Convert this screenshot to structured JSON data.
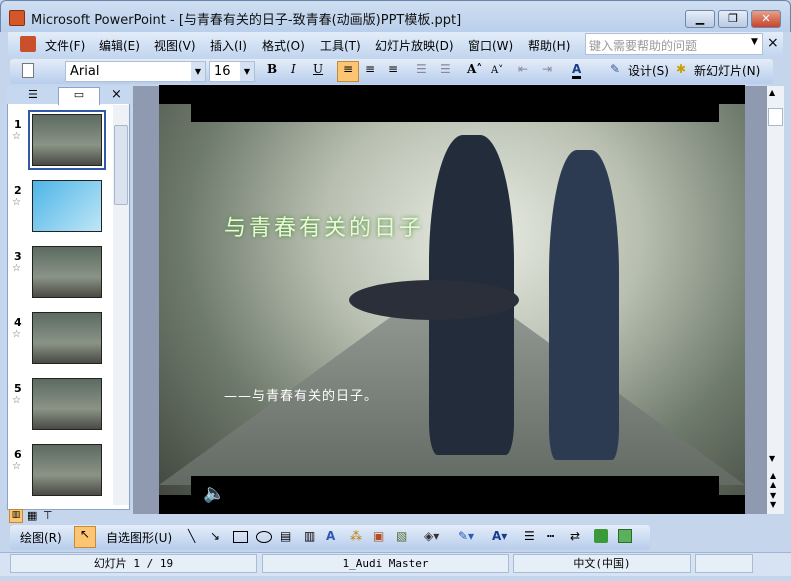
{
  "window": {
    "title": "Microsoft PowerPoint - [与青春有关的日子-致青春(动画版)PPT模板.ppt]",
    "minimize": "▁",
    "restore": "❐",
    "close": "✕"
  },
  "menu": [
    "文件(F)",
    "编辑(E)",
    "视图(V)",
    "插入(I)",
    "格式(O)",
    "工具(T)",
    "幻灯片放映(D)",
    "窗口(W)",
    "帮助(H)"
  ],
  "help": {
    "placeholder": "键入需要帮助的问题",
    "close": "×"
  },
  "toolbar": {
    "font": "Arial",
    "size": "16",
    "bold": "B",
    "italic": "I",
    "underline": "U",
    "grow": "A˄",
    "shrink": "A˅",
    "font_color": "A",
    "design": "设计(S)",
    "new_slide": "新幻灯片(N)"
  },
  "pane": {
    "close": "×",
    "slides": [
      {
        "n": "1",
        "star": "☆"
      },
      {
        "n": "2",
        "star": "☆"
      },
      {
        "n": "3",
        "star": "☆"
      },
      {
        "n": "4",
        "star": "☆"
      },
      {
        "n": "5",
        "star": "☆"
      },
      {
        "n": "6",
        "star": "☆"
      }
    ]
  },
  "slide": {
    "title": "与青春有关的日子",
    "subtitle": "——与青春有关的日子。",
    "sound_icon": "🔈"
  },
  "drawbar": {
    "draw": "绘图(R)",
    "autoshapes": "自选图形(U)"
  },
  "status": {
    "slide": "幻灯片 1 / 19",
    "design": "1_Audi Master",
    "lang": "中文(中国)"
  }
}
